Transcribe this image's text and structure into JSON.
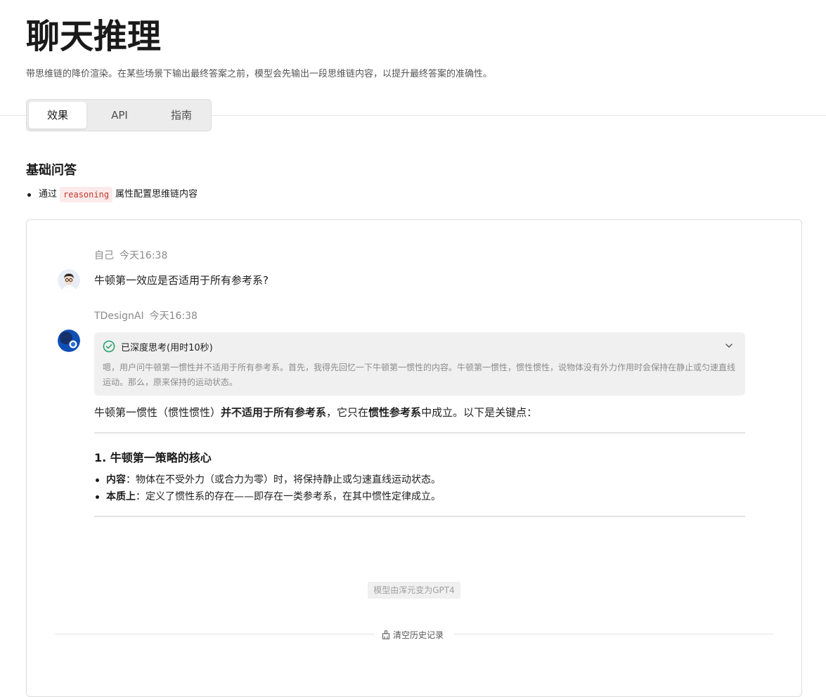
{
  "header": {
    "title": "聊天推理",
    "description": "带思维链的降价渲染。在某些场景下输出最终答案之前，模型会先输出一段思维链内容，以提升最终答案的准确性。"
  },
  "tabs": [
    {
      "label": "效果",
      "active": true
    },
    {
      "label": "API",
      "active": false
    },
    {
      "label": "指南",
      "active": false
    }
  ],
  "section": {
    "title": "基础问答",
    "features": [
      {
        "prefix": "通过",
        "code": "reasoning",
        "suffix": "属性配置思维链内容"
      }
    ]
  },
  "chat": {
    "user": {
      "name": "自己",
      "time": "今天16:38",
      "message": "牛顿第一效应是否适用于所有参考系?"
    },
    "assistant": {
      "name": "TDesignAI",
      "time": "今天16:38",
      "reasoning": {
        "status": "已深度思考(用时10秒)",
        "content": "嗯，用户问牛顿第一惯性并不适用于所有参考系。首先，我得先回忆一下牛顿第一惯性的内容。牛顿第一惯性，惯性惯性，说物体没有外力作用时会保持在静止或匀速直线运动。那么，原来保持的运动状态。"
      },
      "answer": {
        "lead_1": "牛顿第一惯性（惯性惯性）",
        "lead_bold_1": "并不适用于所有参考系",
        "lead_2": "，它只在",
        "lead_bold_2": "惯性参考系",
        "lead_3": "中成立。以下是关键点：",
        "heading": "1. 牛顿第一策略的核心",
        "points": [
          {
            "term": "内容",
            "text": "：物体在不受外力（或合力为零）时，将保持静止或匀速直线运动状态。"
          },
          {
            "term": "本质上",
            "text": "：定义了惯性系的存在——即存在一类参考系，在其中惯性定律成立。"
          }
        ]
      }
    },
    "model_notice": "模型由浑元变为GPT4",
    "clear_history": "清空历史记录"
  },
  "colors": {
    "success": "#2ba471",
    "code_text": "#c0392b",
    "code_bg": "#fbeaea",
    "assistant_avatar": "#0d4fb5"
  },
  "icons": {
    "reasoning_status": "check-circle-icon",
    "reasoning_toggle": "chevron-down-icon",
    "clear": "clear-icon"
  }
}
